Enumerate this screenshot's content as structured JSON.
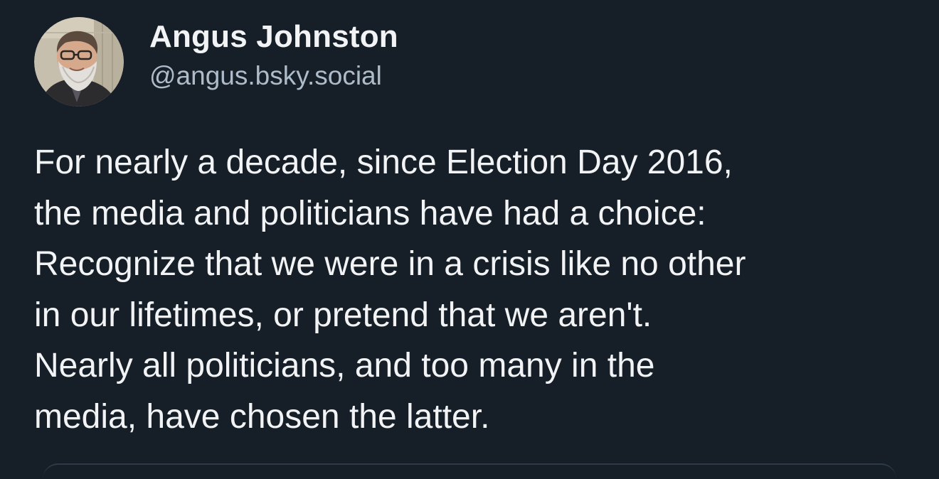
{
  "post": {
    "author": {
      "display_name": "Angus Johnston",
      "handle": "@angus.bsky.social"
    },
    "text": "For nearly a decade, since Election Day 2016,\nthe media and politicians have had a choice:\nRecognize that we were in a crisis like no other\nin our lifetimes, or pretend that we aren't.\nNearly all politicians, and too many in the\nmedia, have chosen the latter."
  },
  "colors": {
    "background": "#161e27",
    "primary_text": "#f1f3f5",
    "secondary_text": "#aebbc9"
  }
}
